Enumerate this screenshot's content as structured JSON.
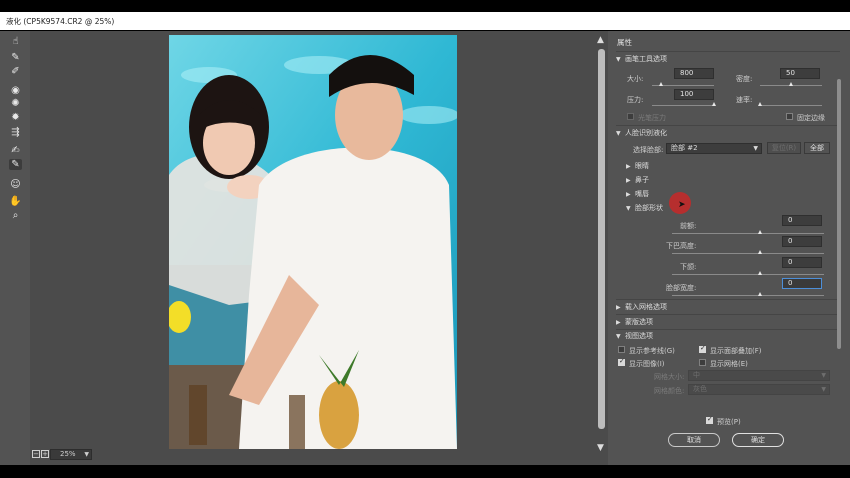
{
  "window": {
    "title": "液化 (CP5K9574.CR2 @ 25%)"
  },
  "toolbar": {
    "tools": [
      {
        "name": "forward-warp-tool",
        "glyph": "☝",
        "active": false
      },
      {
        "name": "reconstruct-tool",
        "glyph": "✎",
        "active": false
      },
      {
        "name": "smooth-tool",
        "glyph": "✐",
        "active": false
      },
      {
        "name": "twirl-tool",
        "glyph": "◉",
        "active": false
      },
      {
        "name": "pucker-tool",
        "glyph": "✺",
        "active": false
      },
      {
        "name": "bloat-tool",
        "glyph": "✹",
        "active": false
      },
      {
        "name": "push-left-tool",
        "glyph": "⇶",
        "active": false
      },
      {
        "name": "freeze-mask-tool",
        "glyph": "✍",
        "active": false
      },
      {
        "name": "thaw-mask-tool",
        "glyph": "✎",
        "active": true
      },
      {
        "name": "face-tool",
        "glyph": "☺",
        "active": false
      },
      {
        "name": "hand-tool",
        "glyph": "✋",
        "active": false
      },
      {
        "name": "zoom-tool",
        "glyph": "⌕",
        "active": false
      }
    ]
  },
  "statusbar": {
    "zoom_out": "−",
    "zoom_in": "+",
    "zoom_value": "25%"
  },
  "panel": {
    "title": "属性",
    "brush_section": {
      "header": "画笔工具选项",
      "size_label": "大小:",
      "size_value": "800",
      "size_level": 0.16,
      "density_label": "密度:",
      "density_value": "50",
      "density_level": 0.5,
      "pressure_label": "压力:",
      "pressure_value": "100",
      "pressure_level": 1.0,
      "rate_label": "速率:",
      "rate_level": 0.0,
      "stylus_label": "光笔压力",
      "pin_edges_label": "固定边缘"
    },
    "face_section": {
      "header": "人脸识别液化",
      "select_face_label": "选择脸部:",
      "select_face_value": "脸部 #2",
      "reset_label": "复位(R)",
      "all_label": "全部",
      "eyes": "眼睛",
      "nose": "鼻子",
      "mouth": "嘴唇",
      "face_shape": "脸部形状",
      "forehead_label": "前额:",
      "forehead_value": "0",
      "chin_label": "下巴高度:",
      "chin_value": "0",
      "jawline_label": "下颌:",
      "jawline_value": "0",
      "face_width_label": "脸部宽度:",
      "face_width_value": "0"
    },
    "load_mesh": "载入网格选项",
    "mask_options": "蒙版选项",
    "view_section": {
      "header": "视图选项",
      "show_guides": "显示参考线(G)",
      "show_guides_checked": false,
      "show_face_overlay": "显示面部叠加(F)",
      "show_face_overlay_checked": true,
      "show_image": "显示图像(I)",
      "show_image_checked": true,
      "show_mesh": "显示网格(E)",
      "show_mesh_checked": false,
      "mesh_size_label": "网格大小:",
      "mesh_size_value": "中",
      "mesh_color_label": "网格颜色:",
      "mesh_color_value": "灰色"
    },
    "preview_label": "预览(P)",
    "preview_checked": true,
    "cancel_label": "取消",
    "ok_label": "确定"
  }
}
